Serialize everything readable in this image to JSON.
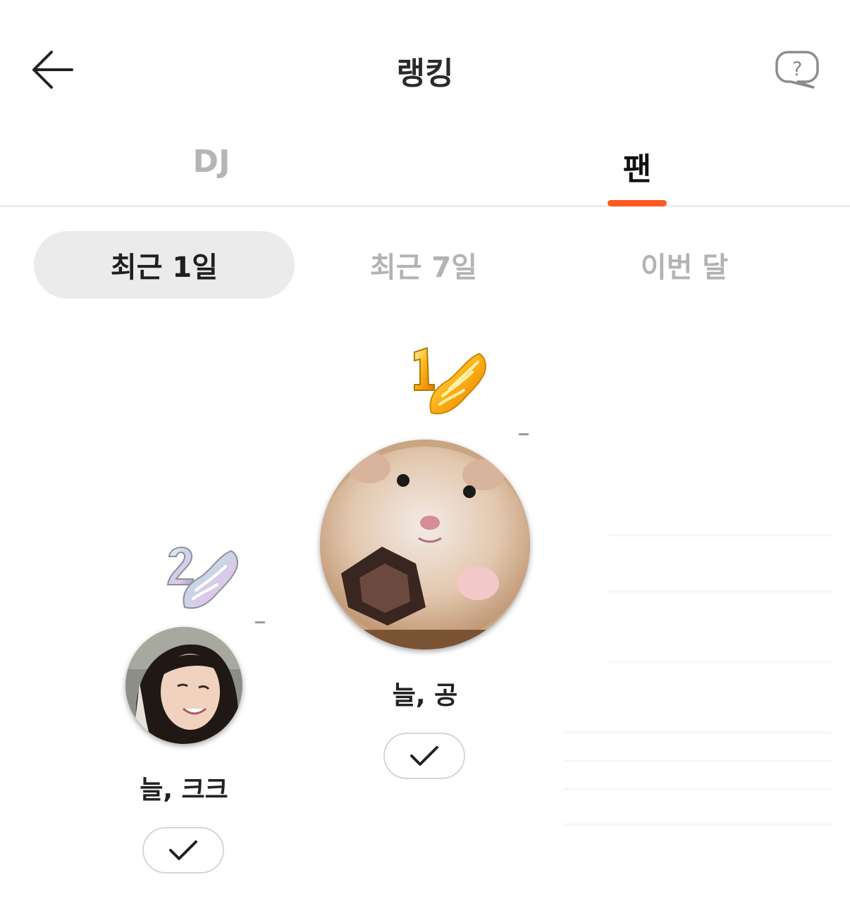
{
  "header": {
    "title": "랭킹"
  },
  "tabs": [
    {
      "label": "DJ",
      "active": false
    },
    {
      "label": "팬",
      "active": true
    }
  ],
  "accent_color": "#ff5a1f",
  "periods": [
    {
      "label": "최근 1일",
      "selected": true
    },
    {
      "label": "최근 7일",
      "selected": false
    },
    {
      "label": "이번 달",
      "selected": false
    }
  ],
  "ranking": [
    {
      "rank": 1,
      "name": "늘, 공",
      "badge": "gold-wing-1-icon",
      "status": "–"
    },
    {
      "rank": 2,
      "name": "늘, 크크",
      "badge": "silver-wing-2-icon",
      "status": "–"
    }
  ]
}
